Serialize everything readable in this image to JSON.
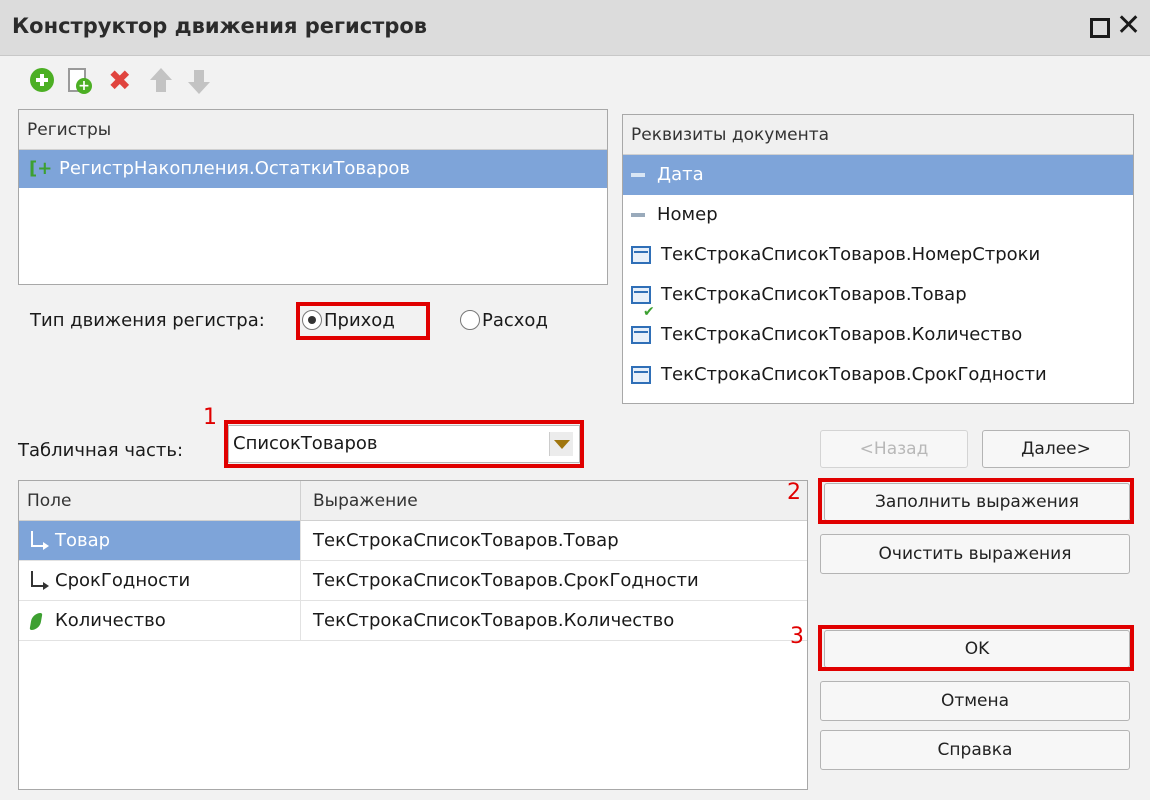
{
  "window": {
    "title": "Конструктор движения регистров"
  },
  "toolbar": {
    "icons": [
      "add-icon",
      "copy-icon",
      "delete-icon",
      "move-up-icon",
      "move-down-icon"
    ]
  },
  "registers": {
    "header": "Регистры",
    "items": [
      {
        "label": "РегистрНакопления.ОстаткиТоваров",
        "selected": true
      }
    ]
  },
  "document_props": {
    "header": "Реквизиты документа",
    "items": [
      {
        "label": "Дата",
        "icon": "dash-icon",
        "selected": true
      },
      {
        "label": "Номер",
        "icon": "dash-icon"
      },
      {
        "label": "ТекСтрокаСписокТоваров.НомерСтроки",
        "icon": "table-icon"
      },
      {
        "label": "ТекСтрокаСписокТоваров.Товар",
        "icon": "table-check-icon"
      },
      {
        "label": "ТекСтрокаСписокТоваров.Количество",
        "icon": "table-icon"
      },
      {
        "label": "ТекСтрокаСписокТоваров.СрокГодности",
        "icon": "table-icon"
      }
    ]
  },
  "movement_type": {
    "label": "Тип движения регистра:",
    "options": [
      {
        "label": "Приход",
        "checked": true
      },
      {
        "label": "Расход",
        "checked": false
      }
    ]
  },
  "tabular_part": {
    "label": "Табличная часть:",
    "value": "СписокТоваров"
  },
  "fields_table": {
    "columns": [
      "Поле",
      "Выражение"
    ],
    "rows": [
      {
        "field": "Товар",
        "expression": "ТекСтрокаСписокТоваров.Товар",
        "icon": "dimension-icon",
        "selected": true
      },
      {
        "field": "СрокГодности",
        "expression": "ТекСтрокаСписокТоваров.СрокГодности",
        "icon": "dimension-icon"
      },
      {
        "field": "Количество",
        "expression": "ТекСтрокаСписокТоваров.Количество",
        "icon": "resource-icon"
      }
    ]
  },
  "buttons": {
    "back": "<Назад",
    "next": "Далее>",
    "fill": "Заполнить выражения",
    "clear": "Очистить выражения",
    "ok": "OK",
    "cancel": "Отмена",
    "help": "Справка"
  },
  "annotations": {
    "marker_1": "1",
    "marker_2": "2",
    "marker_3": "3",
    "color": "#e00000"
  },
  "colors": {
    "selection": "#7ea4d9",
    "add_green": "#4caf24",
    "delete_red": "#e0443e"
  }
}
